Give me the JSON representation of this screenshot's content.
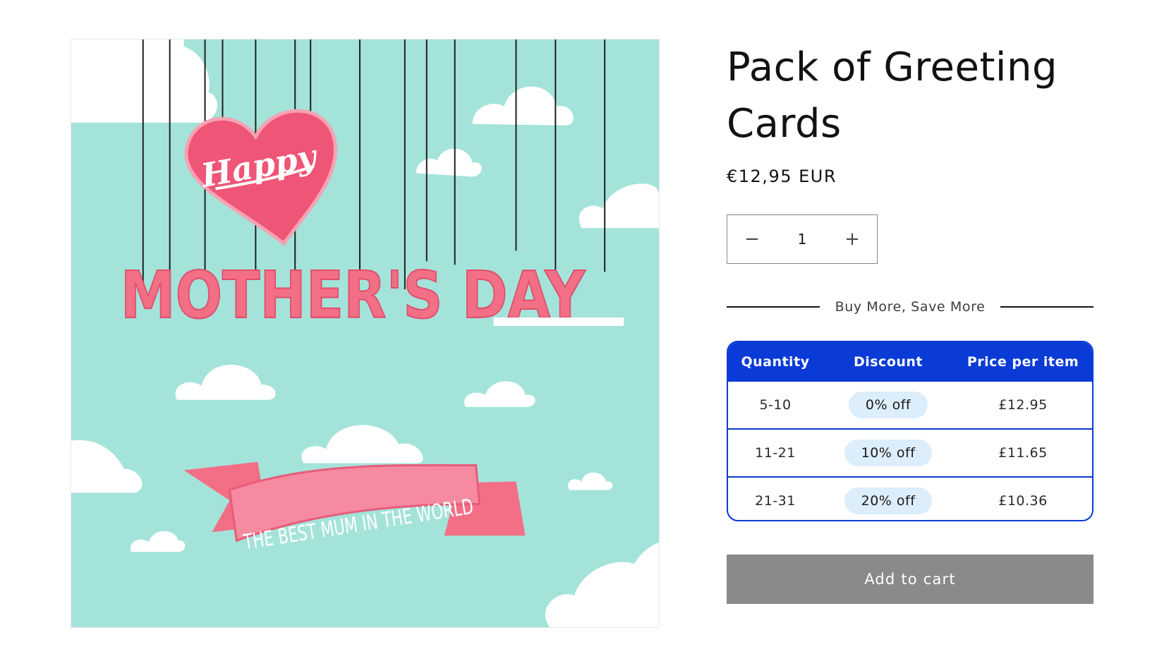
{
  "product": {
    "title": "Pack of Greeting Cards",
    "price": "€12,95 EUR",
    "image": {
      "heart_text": "Happy",
      "headline": "MOTHER'S DAY",
      "banner_text": "THE BEST MUM IN THE WORLD",
      "colors": {
        "sky": "#a4e3da",
        "pink": "#f26f86",
        "heart": "#ef5576",
        "cloud": "#ffffff"
      }
    }
  },
  "quantity": {
    "value": "1",
    "decrease_label": "−",
    "increase_label": "+"
  },
  "tier_section": {
    "label": "Buy More, Save More"
  },
  "tiers": {
    "headers": [
      "Quantity",
      "Discount",
      "Price per item"
    ],
    "rows": [
      {
        "quantity": "5-10",
        "discount": "0% off",
        "price": "£12.95"
      },
      {
        "quantity": "11-21",
        "discount": "10% off",
        "price": "£11.65"
      },
      {
        "quantity": "21-31",
        "discount": "20% off",
        "price": "£10.36"
      }
    ]
  },
  "cart": {
    "add_label": "Add to cart"
  },
  "colors": {
    "accent": "#0a3bd6",
    "pill_bg": "#dcedfb",
    "button_bg": "#8a8a8a"
  }
}
